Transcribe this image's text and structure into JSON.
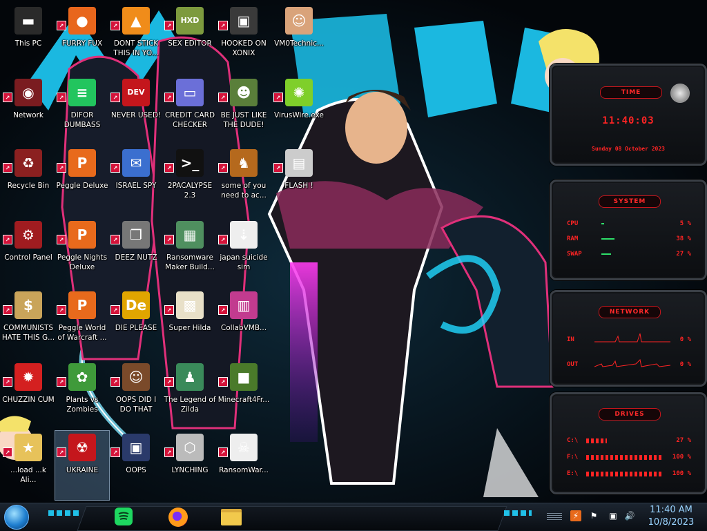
{
  "desktop": {
    "icons": [
      {
        "label": "This PC",
        "glyph": "▬",
        "color": "#2a2a2a"
      },
      {
        "label": "FURRY FUX",
        "glyph": "●",
        "color": "#e8661c"
      },
      {
        "label": "DONT STICK THIS IN YO...",
        "glyph": "▲",
        "color": "#f08c1a"
      },
      {
        "label": "SEX EDITOR",
        "glyph": "HXD",
        "color": "#7d9a3e"
      },
      {
        "label": "HOOKED ON XONIX",
        "glyph": "▣",
        "color": "#3a3a3a"
      },
      {
        "label": "VM0Technic...",
        "glyph": "☺",
        "color": "#d9a37a"
      },
      {
        "label": "Network",
        "glyph": "◉",
        "color": "#7a1c20"
      },
      {
        "label": "DIFOR DUMBASS",
        "glyph": "≡",
        "color": "#22c55e"
      },
      {
        "label": "NEVER USED!",
        "glyph": "DEV",
        "color": "#c4161c"
      },
      {
        "label": "CREDIT CARD CHECKER",
        "glyph": "▭",
        "color": "#6b6fd8"
      },
      {
        "label": "BE JUST LIKE THE DUDE!",
        "glyph": "☻",
        "color": "#5a7f3a"
      },
      {
        "label": "VirusWire.exe",
        "glyph": "✺",
        "color": "#7fcf2a"
      },
      {
        "label": "Recycle Bin",
        "glyph": "♻",
        "color": "#8b2020"
      },
      {
        "label": "Peggle Deluxe",
        "glyph": "P",
        "color": "#e86a1c"
      },
      {
        "label": "ISRAEL SPY",
        "glyph": "✉",
        "color": "#3b6fcf"
      },
      {
        "label": "2PACALYPSE 2.3",
        "glyph": ">_",
        "color": "#111111"
      },
      {
        "label": "some of you need to ac...",
        "glyph": "♞",
        "color": "#b5691d"
      },
      {
        "label": "FLASH !",
        "glyph": "▤",
        "color": "#cccccc"
      },
      {
        "label": "Control Panel",
        "glyph": "⚙",
        "color": "#a01c20"
      },
      {
        "label": "Peggle Nights Deluxe",
        "glyph": "P",
        "color": "#e86a1c"
      },
      {
        "label": "DEEZ NUTZ",
        "glyph": "❐",
        "color": "#777777"
      },
      {
        "label": "Ransomware Maker Build...",
        "glyph": "▦",
        "color": "#4f8f5f"
      },
      {
        "label": "japan suicide sim",
        "glyph": "⇣",
        "color": "#eeeeee"
      },
      {
        "label": "COMMUNISTS HATE THIS G...",
        "glyph": "$",
        "color": "#c9a45a"
      },
      {
        "label": "Peggle World of Warcraft ...",
        "glyph": "P",
        "color": "#e86a1c"
      },
      {
        "label": "DIE PLEASE",
        "glyph": "De",
        "color": "#e0a500"
      },
      {
        "label": "Super Hilda",
        "glyph": "▩",
        "color": "#e8e0c8"
      },
      {
        "label": "CollabVMB...",
        "glyph": "▥",
        "color": "#c23b8f"
      },
      {
        "label": "CHUZZIN CUM",
        "glyph": "✹",
        "color": "#d42020"
      },
      {
        "label": "Plants vs Zombies",
        "glyph": "✿",
        "color": "#3f9a3a"
      },
      {
        "label": "OOPS DID I DO THAT",
        "glyph": "☺",
        "color": "#7a4a2a"
      },
      {
        "label": "The Legend of Zilda",
        "glyph": "♟",
        "color": "#3a8a5a"
      },
      {
        "label": "Minecraft4Fr...",
        "glyph": "■",
        "color": "#4a7a2a"
      },
      {
        "label": "...load ...k Ali...",
        "glyph": "★",
        "color": "#e7c25a"
      },
      {
        "label": "UKRAINE",
        "glyph": "☢",
        "color": "#c4161c"
      },
      {
        "label": "OOPS",
        "glyph": "▣",
        "color": "#2a3a6a"
      },
      {
        "label": "LYNCHING",
        "glyph": "⬡",
        "color": "#bbbbbb"
      },
      {
        "label": "RansomWar...",
        "glyph": "☠",
        "color": "#eeeeee"
      }
    ]
  },
  "gadget": {
    "time": {
      "title": "TIME",
      "clock": "11:40:03",
      "date": "Sunday 08 October 2023"
    },
    "system": {
      "title": "SYSTEM",
      "rows": [
        {
          "k": "CPU",
          "v": "5 %",
          "p": 5
        },
        {
          "k": "RAM",
          "v": "38 %",
          "p": 38
        },
        {
          "k": "SWAP",
          "v": "27 %",
          "p": 27
        }
      ]
    },
    "network": {
      "title": "NETWORK",
      "rows": [
        {
          "k": "IN",
          "v": "0 %"
        },
        {
          "k": "OUT",
          "v": "0 %"
        }
      ]
    },
    "drives": {
      "title": "DRIVES",
      "rows": [
        {
          "k": "C:\\",
          "v": "27 %",
          "p": 27
        },
        {
          "k": "F:\\",
          "v": "100 %",
          "p": 100
        },
        {
          "k": "E:\\",
          "v": "100 %",
          "p": 100
        }
      ]
    }
  },
  "taskbar": {
    "clock_time": "11:40 AM",
    "clock_date": "10/8/2023",
    "pinned": [
      "spotify-icon",
      "firefox-icon",
      "file-explorer-icon"
    ]
  },
  "colors": {
    "accent": "#ff2424",
    "wallpaper_cyan": "#1bb8e0",
    "wallpaper_pink": "#e0307a"
  }
}
